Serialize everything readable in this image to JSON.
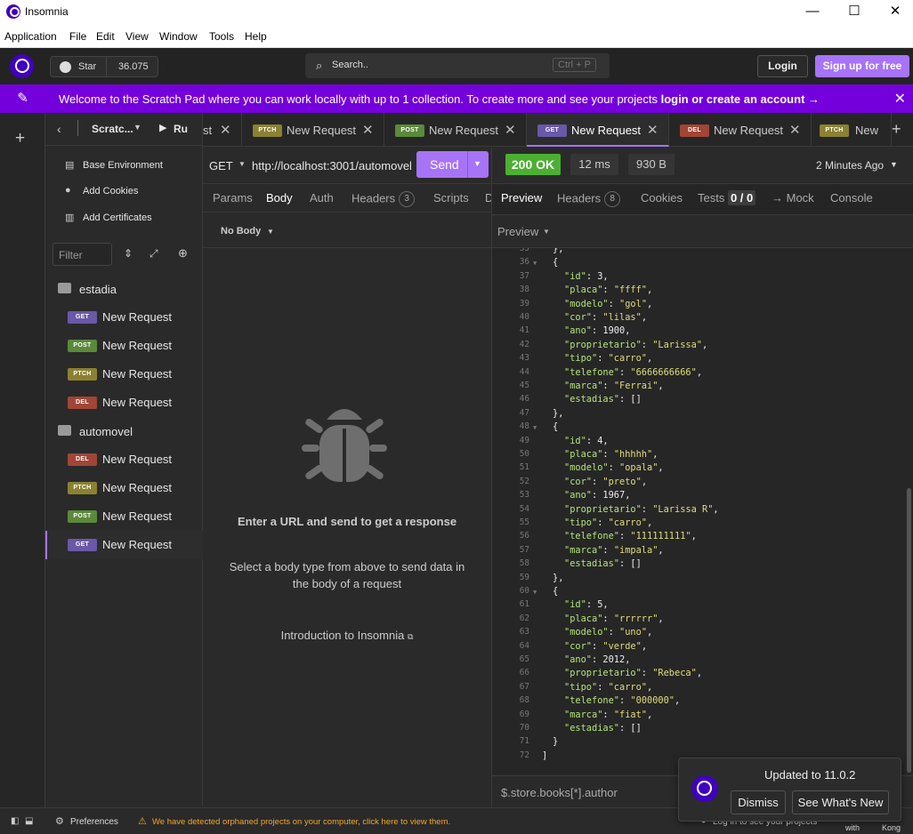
{
  "window": {
    "title": "Insomnia",
    "minimize": "—",
    "maximize": "☐",
    "close": "✕"
  },
  "menu": [
    "Application",
    "File",
    "Edit",
    "View",
    "Window",
    "Tools",
    "Help"
  ],
  "header": {
    "star_label": "Star",
    "star_count": "36.075",
    "search_placeholder": "Search..",
    "search_shortcut": "Ctrl + P",
    "login_label": "Login",
    "signup_label": "Sign up for free"
  },
  "banner": {
    "text": "Welcome to the Scratch Pad where you can work locally with up to 1 collection. To create more and see your projects ",
    "link": "login or create an account →"
  },
  "sidebar": {
    "project_name": "Scratc...",
    "run_label": "Ru",
    "items": [
      "Base Environment",
      "Add Cookies",
      "Add Certificates"
    ],
    "filter_placeholder": "Filter",
    "folders": [
      {
        "name": "estadia",
        "requests": [
          {
            "method": "GET",
            "name": "New Request"
          },
          {
            "method": "POST",
            "name": "New Request"
          },
          {
            "method": "PTCH",
            "name": "New Request"
          },
          {
            "method": "DEL",
            "name": "New Request"
          }
        ]
      },
      {
        "name": "automovel",
        "requests": [
          {
            "method": "DEL",
            "name": "New Request"
          },
          {
            "method": "PTCH",
            "name": "New Request"
          },
          {
            "method": "POST",
            "name": "New Request"
          },
          {
            "method": "GET",
            "name": "New Request"
          }
        ]
      }
    ]
  },
  "tabs": [
    {
      "method": "",
      "label": "st"
    },
    {
      "method": "PTCH",
      "label": "New Request"
    },
    {
      "method": "POST",
      "label": "New Request"
    },
    {
      "method": "GET",
      "label": "New Request"
    },
    {
      "method": "DEL",
      "label": "New Request"
    },
    {
      "method": "PTCH",
      "label": "New"
    }
  ],
  "request": {
    "method": "GET",
    "url": "http://localhost:3001/automovel",
    "send_label": "Send",
    "tabs": [
      "Params",
      "Body",
      "Auth",
      "Headers",
      "Scripts",
      "D"
    ],
    "headers_count": "3",
    "body_type": "No Body",
    "empty_title": "Enter a URL and send to get a response",
    "empty_desc": "Select a body type from above to send data in the body of a request",
    "intro_link": "Introduction to Insomnia"
  },
  "response": {
    "status": "200 OK",
    "time": "12 ms",
    "size": "930 B",
    "age": "2 Minutes Ago",
    "tabs": [
      "Preview",
      "Headers",
      "Cookies",
      "Tests",
      "→ Mock",
      "Console"
    ],
    "headers_count": "8",
    "tests_count": "0 / 0",
    "preview_mode": "Preview",
    "jsonpath_placeholder": "$.store.books[*].author"
  },
  "code_lines": [
    {
      "n": "35",
      "t": "},",
      "fold": false
    },
    {
      "n": "36",
      "t": "{",
      "fold": true
    },
    {
      "n": "37",
      "k": "\"id\"",
      "v": "3",
      "vt": "n",
      "fold": false
    },
    {
      "n": "38",
      "k": "\"placa\"",
      "v": "\"ffff\"",
      "vt": "s",
      "fold": false
    },
    {
      "n": "39",
      "k": "\"modelo\"",
      "v": "\"gol\"",
      "vt": "s",
      "fold": false
    },
    {
      "n": "40",
      "k": "\"cor\"",
      "v": "\"lilas\"",
      "vt": "s",
      "fold": false
    },
    {
      "n": "41",
      "k": "\"ano\"",
      "v": "1900",
      "vt": "n",
      "fold": false
    },
    {
      "n": "42",
      "k": "\"proprietario\"",
      "v": "\"Larissa\"",
      "vt": "s",
      "fold": false
    },
    {
      "n": "43",
      "k": "\"tipo\"",
      "v": "\"carro\"",
      "vt": "s",
      "fold": false
    },
    {
      "n": "44",
      "k": "\"telefone\"",
      "v": "\"6666666666\"",
      "vt": "s",
      "fold": false
    },
    {
      "n": "45",
      "k": "\"marca\"",
      "v": "\"Ferrai\"",
      "vt": "s",
      "fold": false
    },
    {
      "n": "46",
      "k": "\"estadias\"",
      "v": "[]",
      "vt": "n",
      "last": true,
      "fold": false
    },
    {
      "n": "47",
      "t": "},",
      "fold": false
    },
    {
      "n": "48",
      "t": "{",
      "fold": true
    },
    {
      "n": "49",
      "k": "\"id\"",
      "v": "4",
      "vt": "n",
      "fold": false
    },
    {
      "n": "50",
      "k": "\"placa\"",
      "v": "\"hhhhh\"",
      "vt": "s",
      "fold": false
    },
    {
      "n": "51",
      "k": "\"modelo\"",
      "v": "\"opala\"",
      "vt": "s",
      "fold": false
    },
    {
      "n": "52",
      "k": "\"cor\"",
      "v": "\"preto\"",
      "vt": "s",
      "fold": false
    },
    {
      "n": "53",
      "k": "\"ano\"",
      "v": "1967",
      "vt": "n",
      "fold": false
    },
    {
      "n": "54",
      "k": "\"proprietario\"",
      "v": "\"Larissa R\"",
      "vt": "s",
      "fold": false
    },
    {
      "n": "55",
      "k": "\"tipo\"",
      "v": "\"carro\"",
      "vt": "s",
      "fold": false
    },
    {
      "n": "56",
      "k": "\"telefone\"",
      "v": "\"111111111\"",
      "vt": "s",
      "fold": false
    },
    {
      "n": "57",
      "k": "\"marca\"",
      "v": "\"impala\"",
      "vt": "s",
      "fold": false
    },
    {
      "n": "58",
      "k": "\"estadias\"",
      "v": "[]",
      "vt": "n",
      "last": true,
      "fold": false
    },
    {
      "n": "59",
      "t": "},",
      "fold": false
    },
    {
      "n": "60",
      "t": "{",
      "fold": true
    },
    {
      "n": "61",
      "k": "\"id\"",
      "v": "5",
      "vt": "n",
      "fold": false
    },
    {
      "n": "62",
      "k": "\"placa\"",
      "v": "\"rrrrrr\"",
      "vt": "s",
      "fold": false
    },
    {
      "n": "63",
      "k": "\"modelo\"",
      "v": "\"uno\"",
      "vt": "s",
      "fold": false
    },
    {
      "n": "64",
      "k": "\"cor\"",
      "v": "\"verde\"",
      "vt": "s",
      "fold": false
    },
    {
      "n": "65",
      "k": "\"ano\"",
      "v": "2012",
      "vt": "n",
      "fold": false
    },
    {
      "n": "66",
      "k": "\"proprietario\"",
      "v": "\"Rebeca\"",
      "vt": "s",
      "fold": false
    },
    {
      "n": "67",
      "k": "\"tipo\"",
      "v": "\"carro\"",
      "vt": "s",
      "fold": false
    },
    {
      "n": "68",
      "k": "\"telefone\"",
      "v": "\"000000\"",
      "vt": "s",
      "fold": false
    },
    {
      "n": "69",
      "k": "\"marca\"",
      "v": "\"fiat\"",
      "vt": "s",
      "fold": false
    },
    {
      "n": "70",
      "k": "\"estadias\"",
      "v": "[]",
      "vt": "n",
      "last": true,
      "fold": false
    },
    {
      "n": "71",
      "t": "}",
      "fold": false
    },
    {
      "n": "72",
      "t": "]",
      "fold": false,
      "root": true
    }
  ],
  "toast": {
    "title": "Updated to 11.0.2",
    "dismiss_label": "Dismiss",
    "whats_new_label": "See What's New"
  },
  "footer": {
    "preferences_label": "Preferences",
    "warning": "We have detected orphaned projects on your computer, click here to view them.",
    "login_hint": "Log in to see your projects",
    "made_with": "with",
    "kong": "Kong"
  },
  "colors": {
    "accent": "#a773f7",
    "banner": "#7400db",
    "status_ok": "#4caf32",
    "get": "#6a58a8",
    "post": "#5b8a3a",
    "patch": "#8a8132",
    "delete": "#a14536"
  }
}
